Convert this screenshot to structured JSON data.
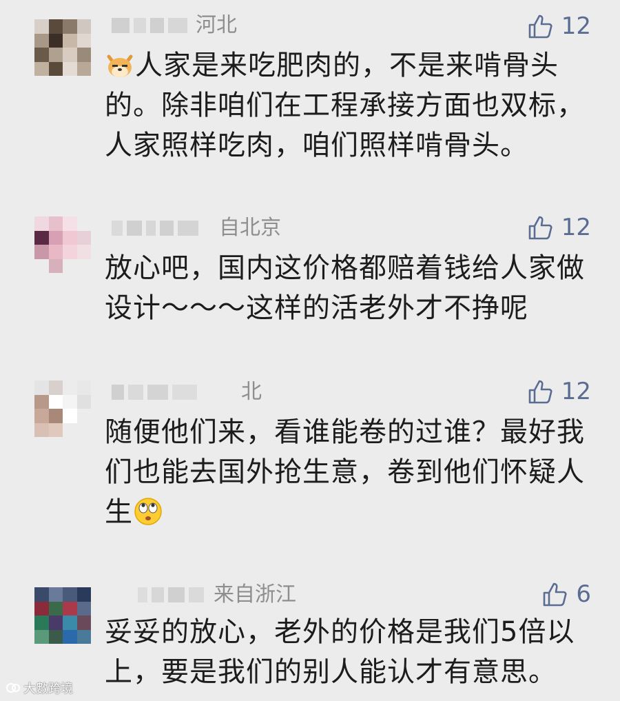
{
  "comments": [
    {
      "location": "河北",
      "likes": "12",
      "emoji_icon": "shiba-dog-emoji",
      "text_lines": [
        "人家是来吃肥肉的，不是来啃骨头",
        "的。除非咱们在工程承接方面也双标，",
        "人家照样吃肉，咱们照样啃骨头。"
      ]
    },
    {
      "location": "自北京",
      "likes": "12",
      "text_lines": [
        "放心吧，国内这价格都赔着钱给人家做",
        "设计～～～这样的活老外才不挣呢"
      ]
    },
    {
      "location": "北",
      "likes": "12",
      "emoji_icon": "rolling-eyes-emoji",
      "text_lines": [
        "随便他们来，看谁能卷的过谁？最好我",
        "们也能去国外抢生意，卷到他们怀疑人",
        "生"
      ]
    },
    {
      "location": "来自浙江",
      "likes": "6",
      "text_lines": [
        "妥妥的放心，老外的价格是我们5倍以",
        "上，要是我们的别人能认才有意思。"
      ]
    }
  ],
  "watermark": {
    "text": "大數跨境"
  },
  "colors": {
    "background": "#ececec",
    "text": "#1c1c1c",
    "location": "#8e8e8e",
    "like": "#5a6c92"
  }
}
